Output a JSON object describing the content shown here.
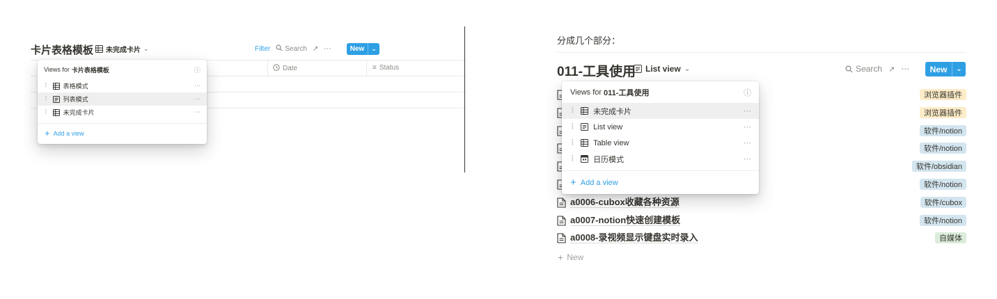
{
  "left": {
    "title": "卡片表格模板",
    "current_view": "未完成卡片",
    "toolbar": {
      "filter": "Filter",
      "search": "Search",
      "new": "New"
    },
    "columns": [
      {
        "label": "Date"
      },
      {
        "label": "Status"
      }
    ],
    "menu": {
      "header_prefix": "Views for ",
      "header_name": "卡片表格模板",
      "items": [
        {
          "label": "表格模式",
          "icon": "table-icon"
        },
        {
          "label": "列表模式",
          "icon": "list-icon"
        },
        {
          "label": "未完成卡片",
          "icon": "table-icon"
        }
      ],
      "active_index": 1,
      "add_label": "Add a view"
    }
  },
  "right": {
    "intro": "分成几个部分：",
    "title": "011-工具使用",
    "current_view": "List view",
    "toolbar": {
      "search": "Search",
      "new": "New"
    },
    "menu": {
      "header_prefix": "Views for ",
      "header_name": "011-工具使用",
      "items": [
        {
          "label": "未完成卡片",
          "icon": "table-icon"
        },
        {
          "label": "List view",
          "icon": "list-icon"
        },
        {
          "label": "Table view",
          "icon": "table-icon"
        },
        {
          "label": "日历模式",
          "icon": "calendar-icon"
        }
      ],
      "active_index": 0,
      "add_label": "Add a view"
    },
    "rows": [
      {
        "name": "",
        "tag": "浏览器插件",
        "tag_color": "#fdecc8"
      },
      {
        "name": "",
        "tag": "浏览器插件",
        "tag_color": "#fdecc8"
      },
      {
        "name": "",
        "tag": "软件/notion",
        "tag_color": "#d3e5ef"
      },
      {
        "name": "",
        "tag": "软件/notion",
        "tag_color": "#d3e5ef"
      },
      {
        "name": "",
        "tag": "软件/obsidian",
        "tag_color": "#d3e5ef"
      },
      {
        "name": "",
        "tag": "软件/notion",
        "tag_color": "#d3e5ef"
      },
      {
        "name": "a0006-cubox收藏各种资源",
        "tag": "软件/cubox",
        "tag_color": "#d3e5ef"
      },
      {
        "name": "a0007-notion快速创建模板",
        "tag": "软件/notion",
        "tag_color": "#d3e5ef"
      },
      {
        "name": "a0008-录视频显示键盘实时录入",
        "tag": "自媒体",
        "tag_color": "#dbeddb"
      }
    ],
    "new_row_label": "New"
  }
}
